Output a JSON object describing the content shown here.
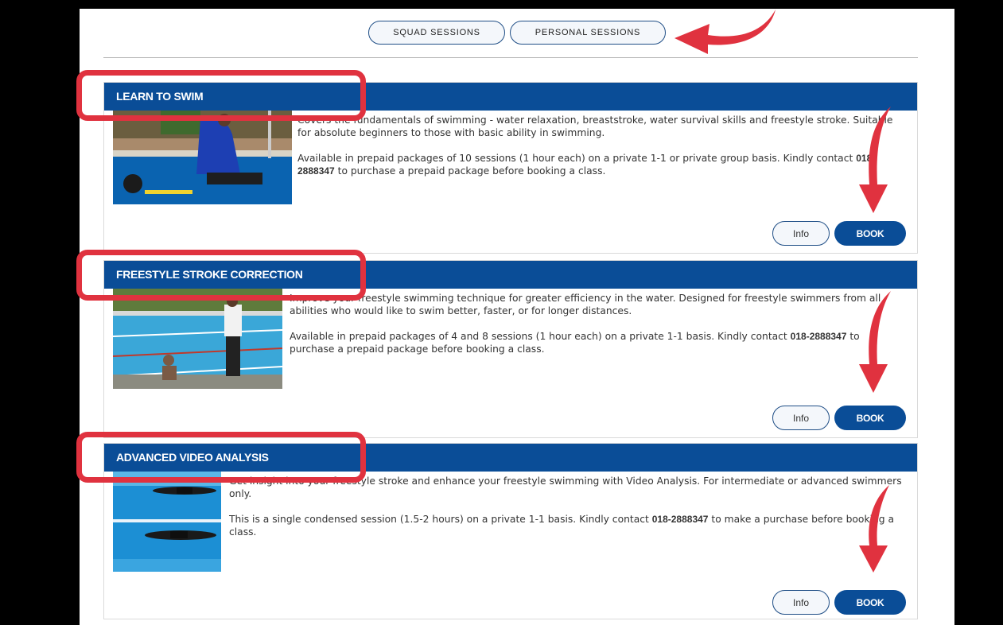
{
  "tabs": {
    "squad": "SQUAD SESSIONS",
    "personal": "PERSONAL SESSIONS"
  },
  "cards": [
    {
      "title": "LEARN TO SWIM",
      "para1": "Covers the fundamentals of swimming - water relaxation, breaststroke, water survival skills and freestyle stroke. Suitable for absolute beginners to those with basic ability in swimming.",
      "para2_a": "Available in prepaid packages of 10 sessions (1 hour each) on a private 1-1 or private group basis. Kindly contact ",
      "phone": "018-2888347",
      "para2_b": " to purchase a prepaid package before booking a class.",
      "info_label": "Info",
      "book_label": "BOOK"
    },
    {
      "title": "FREESTYLE STROKE CORRECTION",
      "para1": "Improve your freestyle swimming technique for greater efficiency in the water. Designed for freestyle swimmers from all abilities who would like to swim better, faster, or for longer distances.",
      "para2_a": "Available in prepaid packages of 4 and 8 sessions (1 hour each) on a private 1-1 basis. Kindly contact ",
      "phone": "018-2888347",
      "para2_b": " to purchase a prepaid package before booking a class.",
      "info_label": "Info",
      "book_label": "BOOK"
    },
    {
      "title": "ADVANCED VIDEO ANALYSIS",
      "para1": "Get insight into your freestyle stroke and enhance your freestyle swimming with Video Analysis. For intermediate or advanced swimmers only.",
      "para2_a": "This is a single condensed session (1.5-2 hours) on a private 1-1 basis. Kindly contact ",
      "phone": "018-2888347",
      "para2_b": " to make a purchase before booking a class.",
      "info_label": "Info",
      "book_label": "BOOK"
    }
  ],
  "colors": {
    "header_blue": "#0a4d97",
    "annotation_red": "#e0323f"
  }
}
